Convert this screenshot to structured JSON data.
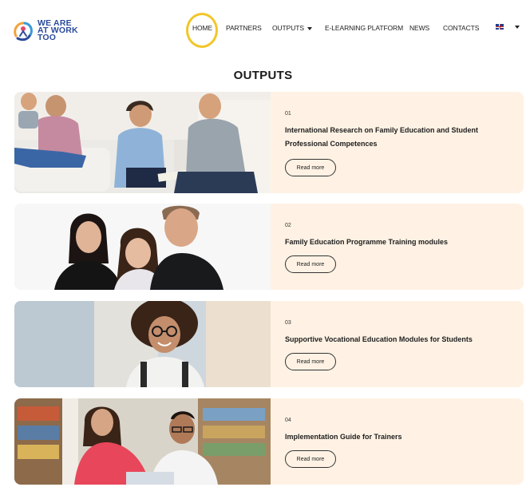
{
  "brand": {
    "logo_lines": [
      "WE ARE",
      "AT WORK",
      "TOO"
    ]
  },
  "nav": {
    "items": [
      {
        "label": "HOME"
      },
      {
        "label": "PARTNERS"
      },
      {
        "label": "OUTPUTS"
      },
      {
        "label": "E-LEARNING PLATFORM"
      },
      {
        "label": "NEWS"
      },
      {
        "label": "CONTACTS"
      }
    ],
    "language_icon": "uk-flag-icon",
    "highlight_color": "#f2c62a"
  },
  "page": {
    "title": "OUTPUTS"
  },
  "cards": [
    {
      "number": "01",
      "title": "International Research on Family Education and Student Professional Competences",
      "button": "Read more",
      "image": "family-studying-photo"
    },
    {
      "number": "02",
      "title": "Family Education Programme Training modules",
      "button": "Read more",
      "image": "family-portrait-photo"
    },
    {
      "number": "03",
      "title": "Supportive Vocational Education Modules for Students",
      "button": "Read more",
      "image": "student-with-glasses-photo"
    },
    {
      "number": "04",
      "title": "Implementation Guide for Trainers",
      "button": "Read more",
      "image": "trainer-in-library-photo"
    }
  ],
  "colors": {
    "card_background": "#fff2e4",
    "logo_blue": "#2a4b9b"
  }
}
